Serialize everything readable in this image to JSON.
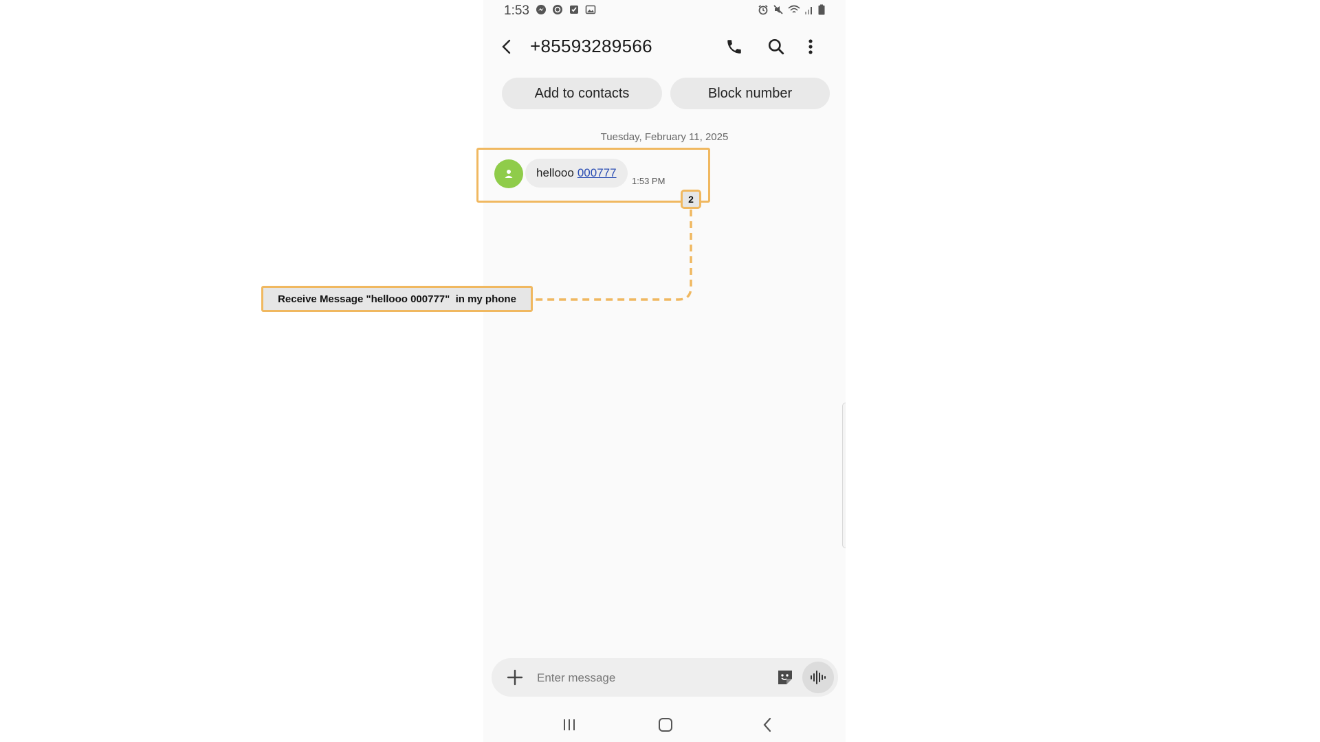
{
  "status_bar": {
    "time": "1:53",
    "left_icons": [
      "messenger-icon",
      "sync-icon",
      "checkbox-icon",
      "gallery-icon"
    ],
    "right_icons": [
      "alarm-icon",
      "mute-icon",
      "wifi-icon",
      "signal-icon",
      "battery-icon"
    ]
  },
  "header": {
    "title": "+85593289566",
    "actions": [
      "phone-icon",
      "search-icon",
      "more-options-icon"
    ]
  },
  "actions": {
    "add_contacts": "Add to contacts",
    "block_number": "Block number"
  },
  "conversation": {
    "date": "Tuesday, February 11, 2025",
    "messages": [
      {
        "text": "hellooo",
        "link": "000777",
        "time": "1:53 PM"
      }
    ]
  },
  "composer": {
    "placeholder": "Enter message"
  },
  "annotation": {
    "step": "2",
    "label": "Receive Message \"hellooo 000777\"  in my phone",
    "color": "#f0b860"
  },
  "colors": {
    "avatar": "#8fcc4a",
    "link": "#2a4db3",
    "pill": "#e9e9e9"
  }
}
